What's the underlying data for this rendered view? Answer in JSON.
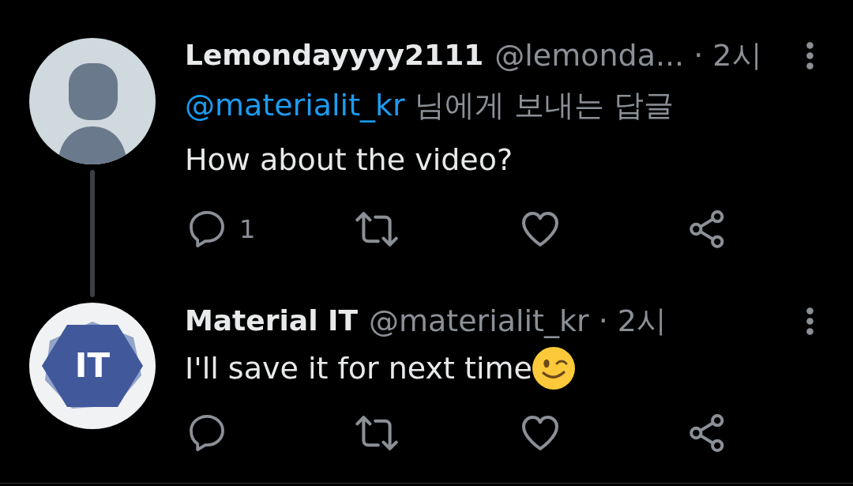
{
  "tweets": [
    {
      "avatar": {
        "kind": "default"
      },
      "name": "Lemondayyyy2111",
      "handle": "@lemonda...",
      "time": "· 2시",
      "thread_continues": true,
      "reply_to": {
        "mention": "@materialit_kr",
        "text": "님에게 보내는 답글"
      },
      "body": "How about the video?",
      "trailing_emoji": false,
      "actions": [
        {
          "kind": "reply",
          "count": "1"
        },
        {
          "kind": "retweet"
        },
        {
          "kind": "like"
        },
        {
          "kind": "share"
        }
      ]
    },
    {
      "avatar": {
        "kind": "logo",
        "text": "IT"
      },
      "name": "Material IT",
      "handle": "@materialit_kr",
      "time": "· 2시",
      "thread_continues": false,
      "body": "I'll save it for next time",
      "trailing_emoji": true,
      "actions": [
        {
          "kind": "reply"
        },
        {
          "kind": "retweet"
        },
        {
          "kind": "like"
        },
        {
          "kind": "share"
        }
      ]
    }
  ]
}
